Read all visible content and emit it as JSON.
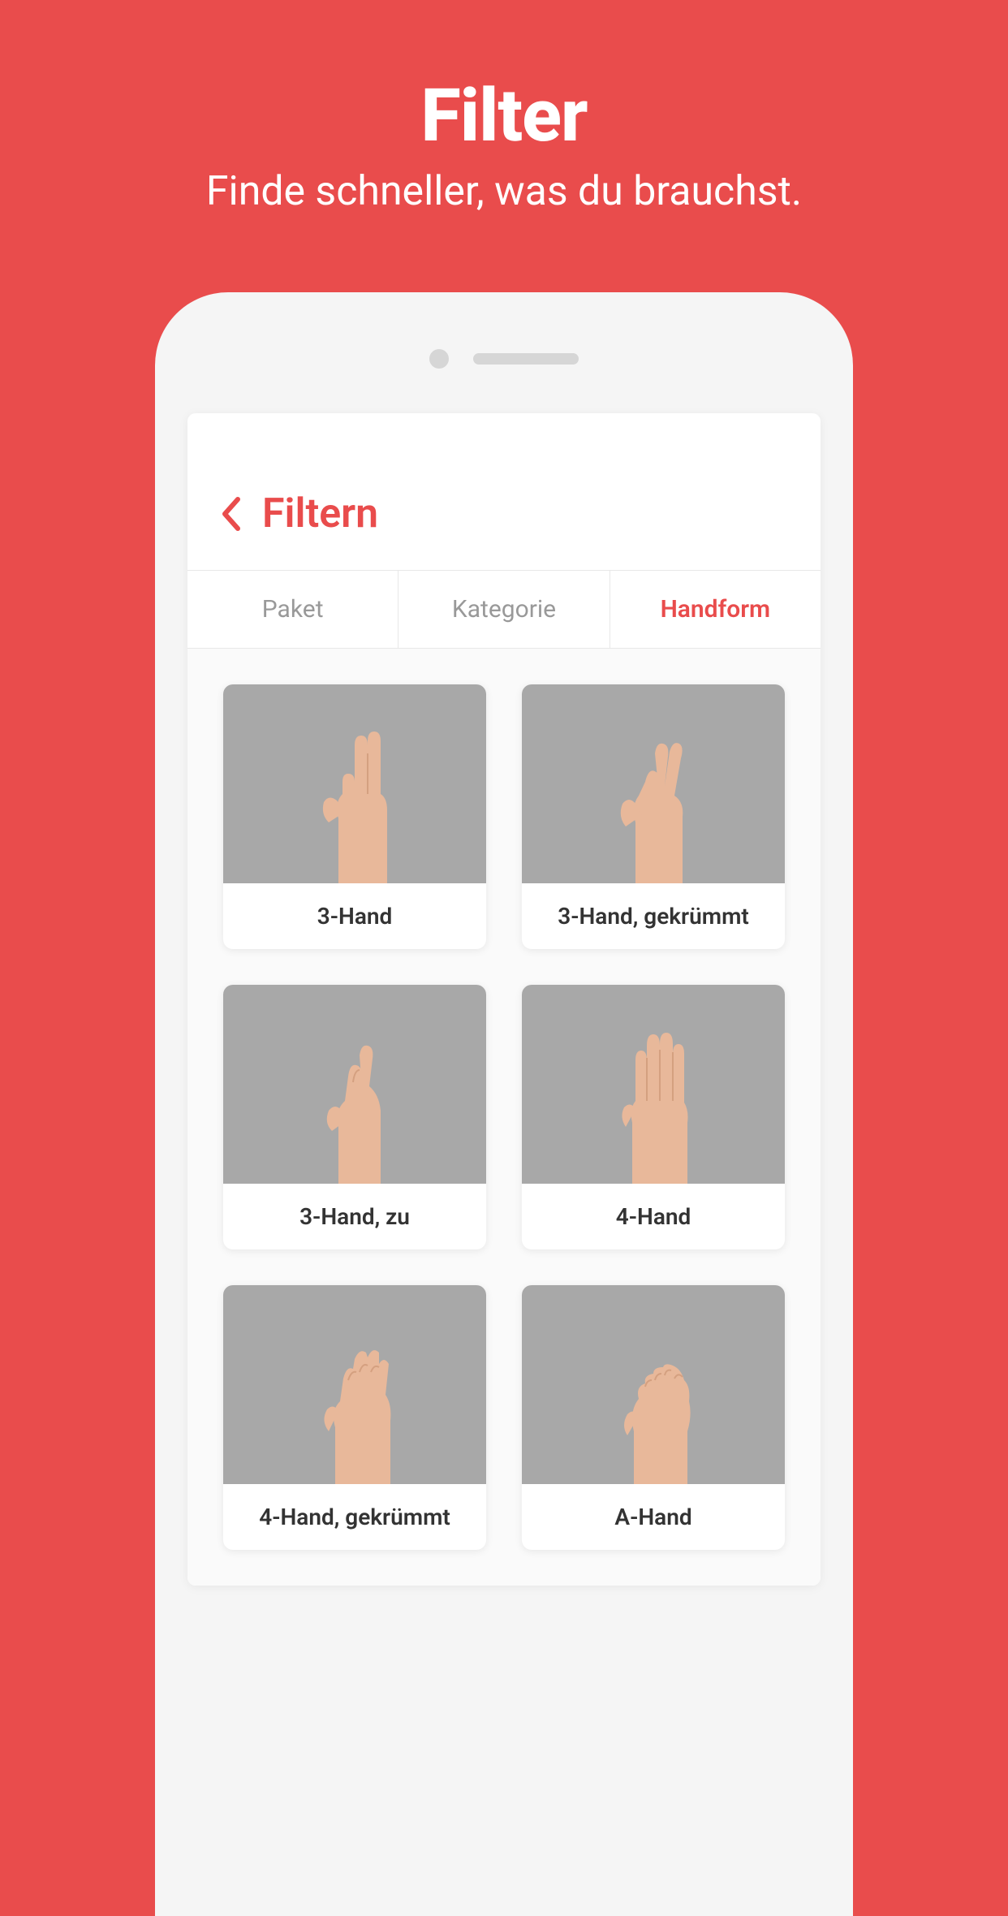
{
  "promo": {
    "title": "Filter",
    "subtitle": "Finde schneller, was du brauchst."
  },
  "header": {
    "title": "Filtern"
  },
  "tabs": [
    {
      "label": "Paket",
      "active": false
    },
    {
      "label": "Kategorie",
      "active": false
    },
    {
      "label": "Handform",
      "active": true
    }
  ],
  "cards": [
    {
      "label": "3-Hand",
      "shape": "three"
    },
    {
      "label": "3-Hand, gekrümmt",
      "shape": "three-bent"
    },
    {
      "label": "3-Hand, zu",
      "shape": "three-closed"
    },
    {
      "label": "4-Hand",
      "shape": "four"
    },
    {
      "label": "4-Hand, gekrümmt",
      "shape": "four-bent"
    },
    {
      "label": "A-Hand",
      "shape": "fist"
    }
  ],
  "colors": {
    "accent": "#e94c4c",
    "skin": "#e8b89a",
    "skinDark": "#d4a080"
  }
}
